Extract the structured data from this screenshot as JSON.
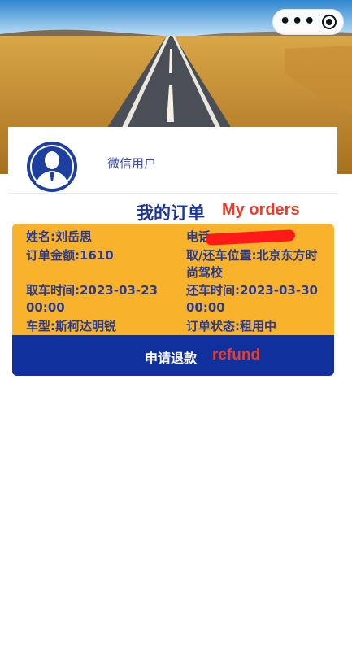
{
  "header": {
    "capsule_icons": [
      "more-dots-icon",
      "close-target-icon"
    ]
  },
  "user": {
    "nickname": "微信用户",
    "avatar_icon": "user-avatar-icon"
  },
  "orders_section": {
    "title_cn": "我的订单",
    "title_en": "My orders"
  },
  "order": {
    "name": "姓名:刘岳思",
    "phone_label": "电话:",
    "amount": "订单金额:1610",
    "location": "取/还车位置:北京东方时尚驾校",
    "pickup_time": "取车时间:2023-03-23 00:00",
    "return_time": "还车时间:2023-03-30 00:00",
    "car_model": "车型:斯柯达明锐",
    "status": "订单状态:租用中",
    "refund_button": "申请退款",
    "refund_en": "refund"
  },
  "colors": {
    "card_bg": "#f9b22b",
    "card_text": "#2a3a8c",
    "refund_bar": "#0f309d",
    "annotation_red": "#ea3d2a",
    "title_blue": "#1c3698"
  }
}
